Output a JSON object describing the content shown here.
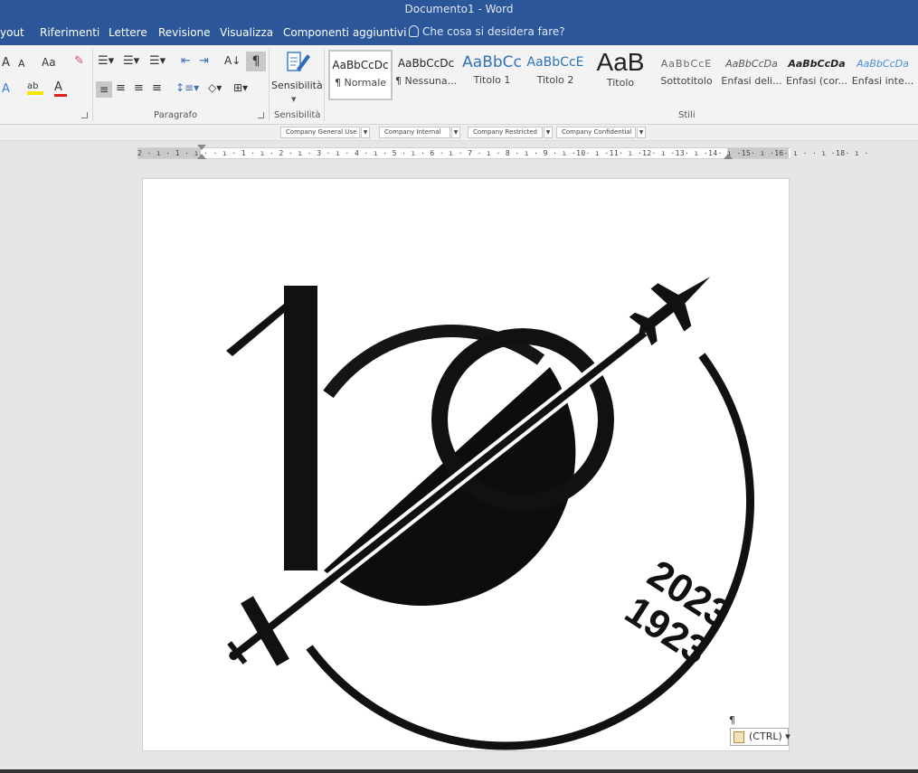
{
  "window": {
    "title": "Documento1 - Word"
  },
  "tabs": [
    {
      "label": "yout"
    },
    {
      "label": "Riferimenti"
    },
    {
      "label": "Lettere"
    },
    {
      "label": "Revisione"
    },
    {
      "label": "Visualizza"
    },
    {
      "label": "Componenti aggiuntivi"
    }
  ],
  "tell_me": {
    "placeholder": "Che cosa si desidera fare?"
  },
  "ribbon": {
    "font_group": {
      "grow_label": "A",
      "shrink_label": "A",
      "case_label": "Aa",
      "highlight_label": "ab",
      "font_color_label": "A",
      "effects_label": "A"
    },
    "paragraph_group": {
      "label": "Paragrafo"
    },
    "sensitivity_group": {
      "button_label": "Sensibilità",
      "label": "Sensibilità"
    },
    "styles_group": {
      "label": "Stili",
      "styles": [
        {
          "sample": "AaBbCcDc",
          "name": "¶ Normale"
        },
        {
          "sample": "AaBbCcDc",
          "name": "¶ Nessuna..."
        },
        {
          "sample": "AaBbCc",
          "name": "Titolo 1"
        },
        {
          "sample": "AaBbCcE",
          "name": "Titolo 2"
        },
        {
          "sample": "AaB",
          "name": "Titolo"
        },
        {
          "sample": "AaBbCcE",
          "name": "Sottotitolo"
        },
        {
          "sample": "AaBbCcDa",
          "name": "Enfasi deli..."
        },
        {
          "sample": "AaBbCcDa",
          "name": "Enfasi (cor..."
        },
        {
          "sample": "AaBbCcDa",
          "name": "Enfasi inte..."
        }
      ]
    }
  },
  "sensitivity_bar": {
    "labels": [
      "Company General Use",
      "Company Internal",
      "Company Restricted",
      "Company Confidential"
    ]
  },
  "ruler": {
    "text": "2 · ı · 1 · ı ·   · ı · 1 · ı · 2 · ı · 3 · ı · 4 · ı · 5 · ı · 6 · ı · 7 · ı · 8 · ı · 9 · ı ·10· ı ·11· ı ·12· ı ·13· ı ·14· ı ·15· ı ·16· ı ·   · ı ·18· ı ·"
  },
  "logo": {
    "year_top": "2023",
    "year_bottom": "1923"
  },
  "document": {
    "pilcrow": "¶",
    "paste_options_label": "(CTRL)"
  },
  "colors": {
    "title_bar": "#2b579a",
    "ribbon": "#f3f3f3",
    "canvas": "#e6e6e6",
    "logo_ink": "#111111"
  }
}
